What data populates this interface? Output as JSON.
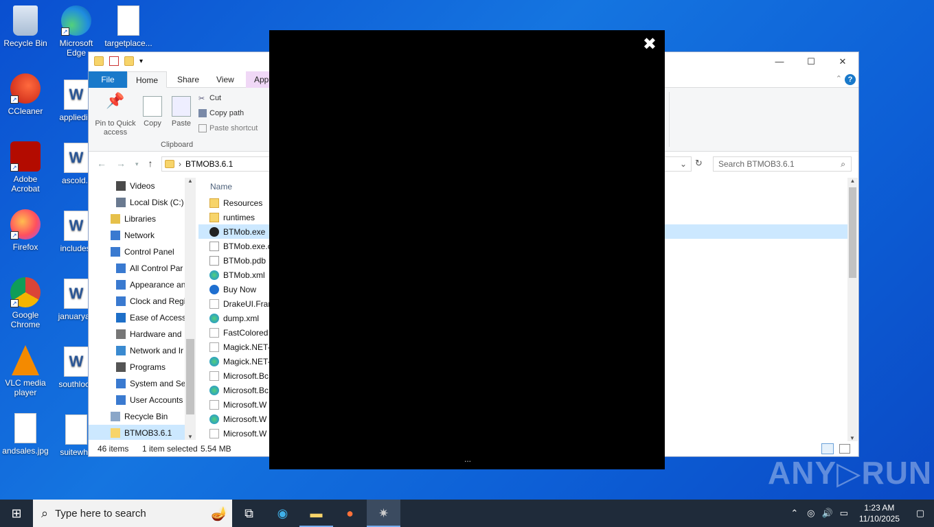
{
  "desktop": {
    "icons": [
      {
        "label": "Recycle Bin",
        "icon": "recycle-bin-icon"
      },
      {
        "label": "Microsoft Edge",
        "icon": "edge-icon"
      },
      {
        "label": "targetplace...",
        "icon": "image-file-icon"
      },
      {
        "label": "CCleaner",
        "icon": "ccleaner-icon"
      },
      {
        "label": "appliediiii",
        "icon": "word-doc-icon"
      },
      {
        "label": "Adobe Acrobat",
        "icon": "acrobat-icon"
      },
      {
        "label": "ascold.r",
        "icon": "word-doc-icon"
      },
      {
        "label": "Firefox",
        "icon": "firefox-icon"
      },
      {
        "label": "includesj",
        "icon": "word-doc-icon"
      },
      {
        "label": "Google Chrome",
        "icon": "chrome-icon"
      },
      {
        "label": "januaryab",
        "icon": "word-doc-icon"
      },
      {
        "label": "VLC media player",
        "icon": "vlc-icon"
      },
      {
        "label": "southloca",
        "icon": "word-doc-icon"
      },
      {
        "label": "andsales.jpg",
        "icon": "image-file-icon"
      },
      {
        "label": "suitewho",
        "icon": "image-file-icon"
      }
    ]
  },
  "explorer": {
    "window_controls": {
      "minimize": "—",
      "maximize": "☐",
      "close": "✕"
    },
    "tabs": {
      "file": "File",
      "home": "Home",
      "share": "Share",
      "view": "View",
      "app": "App"
    },
    "ribbon": {
      "pin": "Pin to Quick access",
      "copy": "Copy",
      "paste": "Paste",
      "cut": "Cut",
      "copy_path": "Copy path",
      "paste_shortcut": "Paste shortcut",
      "group_clipboard": "Clipboard"
    },
    "address": {
      "path": "BTMOB3.6.1"
    },
    "search": {
      "placeholder": "Search BTMOB3.6.1"
    },
    "nav_items": [
      {
        "label": "Videos",
        "indent": 1
      },
      {
        "label": "Local Disk (C:)",
        "indent": 1
      },
      {
        "label": "Libraries",
        "indent": 0
      },
      {
        "label": "Network",
        "indent": 0
      },
      {
        "label": "Control Panel",
        "indent": 0
      },
      {
        "label": "All Control Par",
        "indent": 1
      },
      {
        "label": "Appearance an",
        "indent": 1
      },
      {
        "label": "Clock and Regi",
        "indent": 1
      },
      {
        "label": "Ease of Access",
        "indent": 1
      },
      {
        "label": "Hardware and",
        "indent": 1
      },
      {
        "label": "Network and Ir",
        "indent": 1
      },
      {
        "label": "Programs",
        "indent": 1
      },
      {
        "label": "System and Se",
        "indent": 1
      },
      {
        "label": "User Accounts",
        "indent": 1
      },
      {
        "label": "Recycle Bin",
        "indent": 0
      },
      {
        "label": "BTMOB3.6.1",
        "indent": 0,
        "selected": true
      }
    ],
    "column_name": "Name",
    "files": [
      {
        "name": "Resources",
        "type": "folder"
      },
      {
        "name": "runtimes",
        "type": "folder"
      },
      {
        "name": "BTMob.exe",
        "type": "exe",
        "selected": true
      },
      {
        "name": "BTMob.exe.c",
        "type": "file"
      },
      {
        "name": "BTMob.pdb",
        "type": "file"
      },
      {
        "name": "BTMob.xml",
        "type": "edge"
      },
      {
        "name": "Buy Now",
        "type": "url"
      },
      {
        "name": "DrakeUI.Fran",
        "type": "dll"
      },
      {
        "name": "dump.xml",
        "type": "edge"
      },
      {
        "name": "FastColored",
        "type": "dll"
      },
      {
        "name": "Magick.NET-",
        "type": "dll"
      },
      {
        "name": "Magick.NET-",
        "type": "edge"
      },
      {
        "name": "Microsoft.Bc",
        "type": "dll"
      },
      {
        "name": "Microsoft.Bc",
        "type": "edge"
      },
      {
        "name": "Microsoft.W",
        "type": "dll"
      },
      {
        "name": "Microsoft.W",
        "type": "edge"
      },
      {
        "name": "Microsoft.W",
        "type": "dll"
      }
    ],
    "status": {
      "items": "46 items",
      "selected": "1 item selected",
      "size": "5.54 MB"
    }
  },
  "overlay": {
    "close": "✖",
    "dots": "..."
  },
  "watermark": "ANY▷RUN",
  "taskbar": {
    "search_placeholder": "Type here to search",
    "time": "1:23 AM",
    "date": "11/10/2025"
  },
  "colors": {
    "accent": "#1979ca",
    "selection": "#cce8ff",
    "taskbar": "#1f2b3a"
  }
}
